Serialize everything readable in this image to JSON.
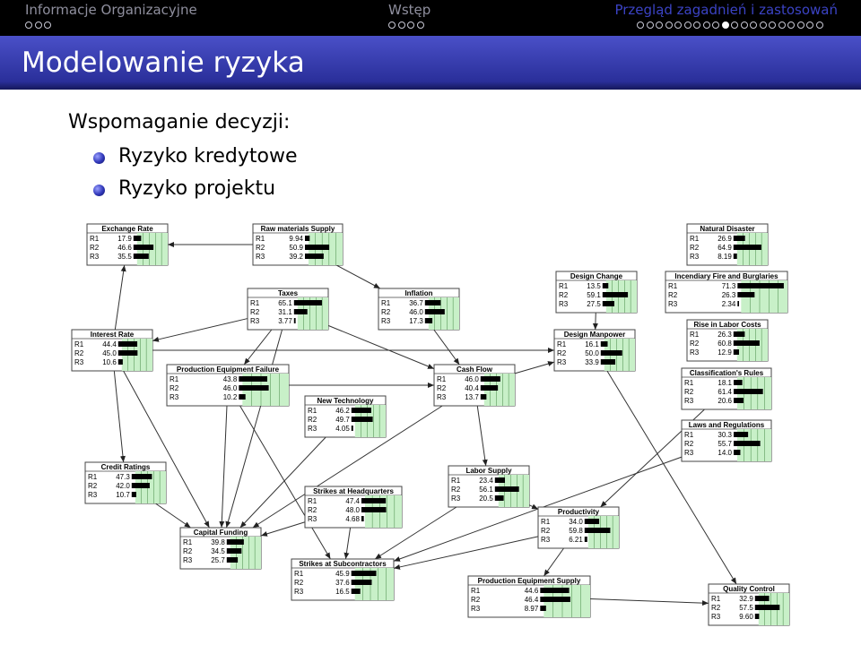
{
  "header": {
    "sections": [
      "Informacje Organizacyjne",
      "Wstęp",
      "Przegląd zagadnień i zastosowań"
    ],
    "nav_dots": [
      3,
      4,
      20
    ],
    "current_dot": 9,
    "colors": {
      "bar": "#000000",
      "title_bg": "#2f35a8",
      "active_section": "#3b43c4",
      "box_fill": "#c8f0c8"
    }
  },
  "title": "Modelowanie ryzyka",
  "intro": "Wspomaganie decyzji:",
  "items": [
    "Ryzyko kredytowe",
    "Ryzyko projektu"
  ],
  "network": {
    "row_labels": [
      "R1",
      "R2",
      "R3"
    ],
    "nodes": [
      {
        "id": "exchange",
        "title": "Exchange Rate",
        "values": [
          "17.9",
          "46.6",
          "35.5"
        ]
      },
      {
        "id": "rawmat",
        "title": "Raw materials Supply",
        "values": [
          "9.94",
          "50.9",
          "39.2"
        ]
      },
      {
        "id": "natdis",
        "title": "Natural Disaster",
        "values": [
          "26.9",
          "64.9",
          "8.19"
        ]
      },
      {
        "id": "design",
        "title": "Design Change",
        "values": [
          "13.5",
          "59.1",
          "27.5"
        ]
      },
      {
        "id": "fire",
        "title": "Incendiary Fire and Burglaries",
        "values": [
          "71.3",
          "26.3",
          "2.34"
        ]
      },
      {
        "id": "taxes",
        "title": "Taxes",
        "values": [
          "65.1",
          "31.1",
          "3.77"
        ]
      },
      {
        "id": "inflation",
        "title": "Inflation",
        "values": [
          "36.7",
          "46.0",
          "17.3"
        ]
      },
      {
        "id": "labor_costs",
        "title": "Rise in Labor Costs",
        "values": [
          "26.3",
          "60.8",
          "12.9"
        ]
      },
      {
        "id": "interest",
        "title": "Interest Rate",
        "values": [
          "44.4",
          "45.0",
          "10.6"
        ]
      },
      {
        "id": "manpower",
        "title": "Design Manpower",
        "values": [
          "16.1",
          "50.0",
          "33.9"
        ]
      },
      {
        "id": "pef",
        "title": "Production Equipment Failure",
        "values": [
          "43.8",
          "46.0",
          "10.2"
        ]
      },
      {
        "id": "cashflow",
        "title": "Cash Flow",
        "values": [
          "46.0",
          "40.4",
          "13.7"
        ]
      },
      {
        "id": "classrules",
        "title": "Classification's Rules",
        "values": [
          "18.1",
          "61.4",
          "20.6"
        ]
      },
      {
        "id": "newtech",
        "title": "New Technology",
        "values": [
          "46.2",
          "49.7",
          "4.05"
        ]
      },
      {
        "id": "laws",
        "title": "Laws and Regulations",
        "values": [
          "30.3",
          "55.7",
          "14.0"
        ]
      },
      {
        "id": "credit",
        "title": "Credit Ratings",
        "values": [
          "47.3",
          "42.0",
          "10.7"
        ]
      },
      {
        "id": "laborsupply",
        "title": "Labor Supply",
        "values": [
          "23.4",
          "56.1",
          "20.5"
        ]
      },
      {
        "id": "strikes_hq",
        "title": "Strikes at Headquarters",
        "values": [
          "47.4",
          "48.0",
          "4.68"
        ]
      },
      {
        "id": "productivity",
        "title": "Productivity",
        "values": [
          "34.0",
          "59.8",
          "6.21"
        ]
      },
      {
        "id": "capital",
        "title": "Capital Funding",
        "values": [
          "39.8",
          "34.5",
          "25.7"
        ]
      },
      {
        "id": "strikes_sub",
        "title": "Strikes at Subcontractors",
        "values": [
          "45.9",
          "37.6",
          "16.5"
        ]
      },
      {
        "id": "pes",
        "title": "Production Equipment Supply",
        "values": [
          "44.6",
          "46.4",
          "8.97"
        ]
      },
      {
        "id": "quality",
        "title": "Quality Control",
        "values": [
          "32.9",
          "57.5",
          "9.60"
        ]
      }
    ],
    "edges": [
      [
        "rawmat",
        "exchange"
      ],
      [
        "rawmat",
        "inflation"
      ],
      [
        "interest",
        "exchange"
      ],
      [
        "taxes",
        "interest"
      ],
      [
        "taxes",
        "pef"
      ],
      [
        "taxes",
        "capital"
      ],
      [
        "inflation",
        "cashflow"
      ],
      [
        "interest",
        "manpower"
      ],
      [
        "interest",
        "credit"
      ],
      [
        "interest",
        "capital"
      ],
      [
        "pef",
        "cashflow"
      ],
      [
        "pef",
        "capital"
      ],
      [
        "newtech",
        "capital"
      ],
      [
        "cashflow",
        "capital"
      ],
      [
        "cashflow",
        "manpower"
      ],
      [
        "cashflow",
        "laborsupply"
      ],
      [
        "credit",
        "capital"
      ],
      [
        "strikes_hq",
        "capital"
      ],
      [
        "strikes_hq",
        "strikes_sub"
      ],
      [
        "laborsupply",
        "strikes_sub"
      ],
      [
        "laborsupply",
        "productivity"
      ],
      [
        "productivity",
        "strikes_sub"
      ],
      [
        "productivity",
        "pes"
      ],
      [
        "design",
        "manpower"
      ],
      [
        "manpower",
        "quality"
      ],
      [
        "pes",
        "quality"
      ],
      [
        "laws",
        "strikes_sub"
      ],
      [
        "classrules",
        "productivity"
      ],
      [
        "pef",
        "strikes_sub"
      ],
      [
        "taxes",
        "cashflow"
      ]
    ]
  }
}
